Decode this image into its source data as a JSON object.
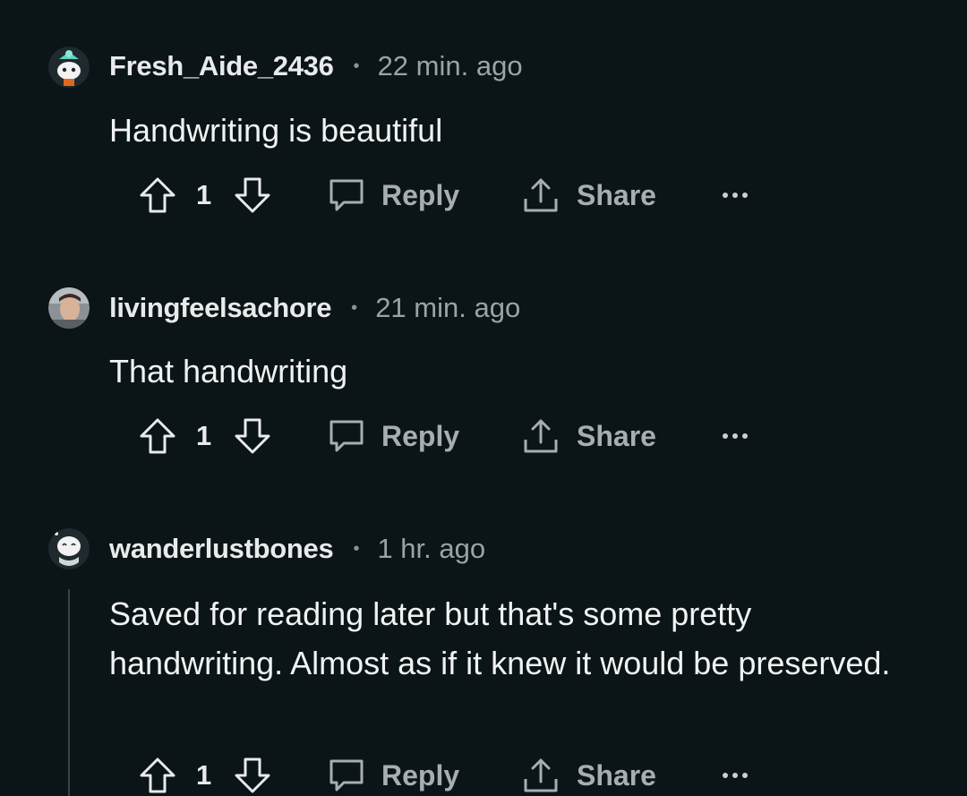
{
  "comments": [
    {
      "username": "Fresh_Aide_2436",
      "separator": "•",
      "time": "22 min. ago",
      "body": "Handwriting is beautiful",
      "votes": "1",
      "reply_label": "Reply",
      "share_label": "Share",
      "avatar_icon": "snoo-avatar-teal-hat"
    },
    {
      "username": "livingfeelsachore",
      "separator": "•",
      "time": "21 min. ago",
      "body": "That handwriting",
      "votes": "1",
      "reply_label": "Reply",
      "share_label": "Share",
      "avatar_icon": "photo-avatar"
    },
    {
      "username": "wanderlustbones",
      "separator": "•",
      "time": "1 hr. ago",
      "body": "Saved for reading later but that's some pretty handwriting. Almost as if it knew it would be preserved.",
      "votes": "1",
      "reply_label": "Reply",
      "share_label": "Share",
      "avatar_icon": "snoo-avatar-scarf"
    }
  ],
  "colors": {
    "background": "#0b1416",
    "text": "#f0f2f3",
    "meta": "#9aa3a7",
    "action": "#a6aeb2"
  }
}
